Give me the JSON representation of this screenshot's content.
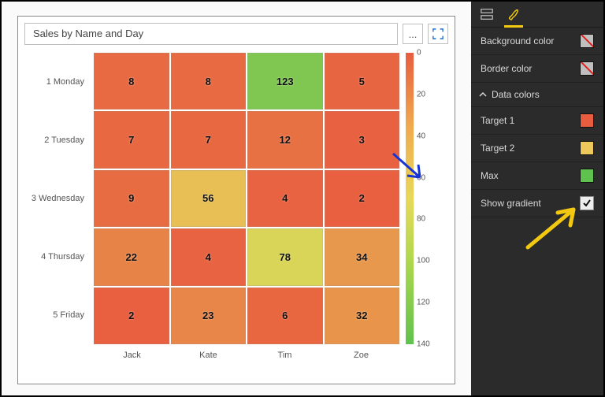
{
  "visual": {
    "title": "Sales by Name and Day",
    "more_tooltip": "...",
    "focus_tooltip": "Focus mode"
  },
  "chart_data": {
    "type": "heatmap",
    "title": "Sales by Name and Day",
    "x_categories": [
      "Jack",
      "Kate",
      "Tim",
      "Zoe"
    ],
    "y_categories": [
      "1 Monday",
      "2 Tuesday",
      "3 Wednesday",
      "4 Thursday",
      "5 Friday"
    ],
    "values": [
      [
        8,
        8,
        123,
        5
      ],
      [
        7,
        7,
        12,
        3
      ],
      [
        9,
        56,
        4,
        2
      ],
      [
        22,
        4,
        78,
        34
      ],
      [
        2,
        23,
        6,
        32
      ]
    ],
    "colorscale": {
      "min_color": "#e85c3f",
      "mid_color": "#e8d85a",
      "max_color": "#5fc24e",
      "range": [
        0,
        140
      ],
      "ticks": [
        0,
        20,
        40,
        60,
        80,
        100,
        120,
        140
      ],
      "reversed_value_axis": true
    }
  },
  "pane": {
    "background_color_label": "Background color",
    "border_color_label": "Border color",
    "data_colors_label": "Data colors",
    "target1": {
      "label": "Target 1",
      "color": "#e85c3f"
    },
    "target2": {
      "label": "Target 2",
      "color": "#ecc95a"
    },
    "max": {
      "label": "Max",
      "color": "#5fc24e"
    },
    "show_gradient_label": "Show gradient",
    "show_gradient_checked": true
  }
}
